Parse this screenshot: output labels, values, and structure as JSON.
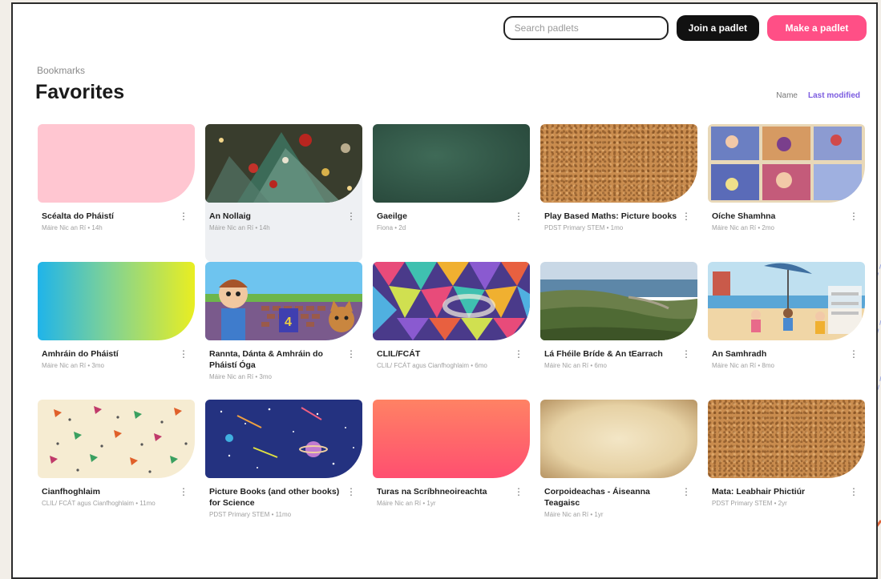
{
  "header": {
    "search_placeholder": "Search padlets",
    "join_label": "Join a padlet",
    "make_label": "Make a padlet"
  },
  "breadcrumb": "Bookmarks",
  "page_title": "Favorites",
  "sort": {
    "name_label": "Name",
    "modified_label": "Last modified"
  },
  "cards": [
    {
      "title": "Scéalta do Pháistí",
      "sub": "Máire Nic an Rí • 14h",
      "thumb": "pink-solid"
    },
    {
      "title": "An Nollaig",
      "sub": "Máire Nic an Rí • 14h",
      "thumb": "christmas-tree-photo"
    },
    {
      "title": "Gaeilge",
      "sub": "Fiona • 2d",
      "thumb": "green-chalkboard"
    },
    {
      "title": "Play Based Maths: Picture books",
      "sub": "PDST Primary STEM • 1mo",
      "thumb": "corkboard"
    },
    {
      "title": "Oíche Shamhna",
      "sub": "Máire Nic an Rí • 2mo",
      "thumb": "comic-panels"
    },
    {
      "title": "Amhráin do Pháistí",
      "sub": "Máire Nic an Rí • 3mo",
      "thumb": "rainbow-gradient"
    },
    {
      "title": "Rannta, Dánta & Amhráin do Pháistí Óga",
      "sub": "Máire Nic an Rí • 3mo",
      "thumb": "cartoon-boy-and-cat"
    },
    {
      "title": "CLIL/FCÁT",
      "sub": "CLIL/ FCÁT agus Cianfhoghlaim • 6mo",
      "thumb": "colorful-3d-pattern"
    },
    {
      "title": "Lá Fhéile Bríde & An tEarrach",
      "sub": "Máire Nic an Rí • 6mo",
      "thumb": "coastline-photo"
    },
    {
      "title": "An Samhradh",
      "sub": "Máire Nic an Rí • 8mo",
      "thumb": "beach-scene"
    },
    {
      "title": "Cianfhoghlaim",
      "sub": "CLIL/ FCÁT agus Cianfhoghlaim • 11mo",
      "thumb": "carrot-pattern"
    },
    {
      "title": "Picture Books (and other books) for Science",
      "sub": "PDST Primary STEM • 11mo",
      "thumb": "space-scene"
    },
    {
      "title": "Turas na Scríbhneoireachta",
      "sub": "Máire Nic an Rí • 1yr",
      "thumb": "sunset-gradient"
    },
    {
      "title": "Corpoideachas - Áiseanna Teagaisc",
      "sub": "Máire Nic an Rí • 1yr",
      "thumb": "parchment"
    },
    {
      "title": "Mata: Leabhair Phictiúr",
      "sub": "PDST Primary STEM • 2yr",
      "thumb": "corkboard"
    }
  ],
  "colors": {
    "accent_pink": "#ff4f86",
    "active_sort": "#7c5ce0",
    "dark_button": "#111111"
  },
  "icons": {
    "card_menu": "kebab-icon"
  }
}
